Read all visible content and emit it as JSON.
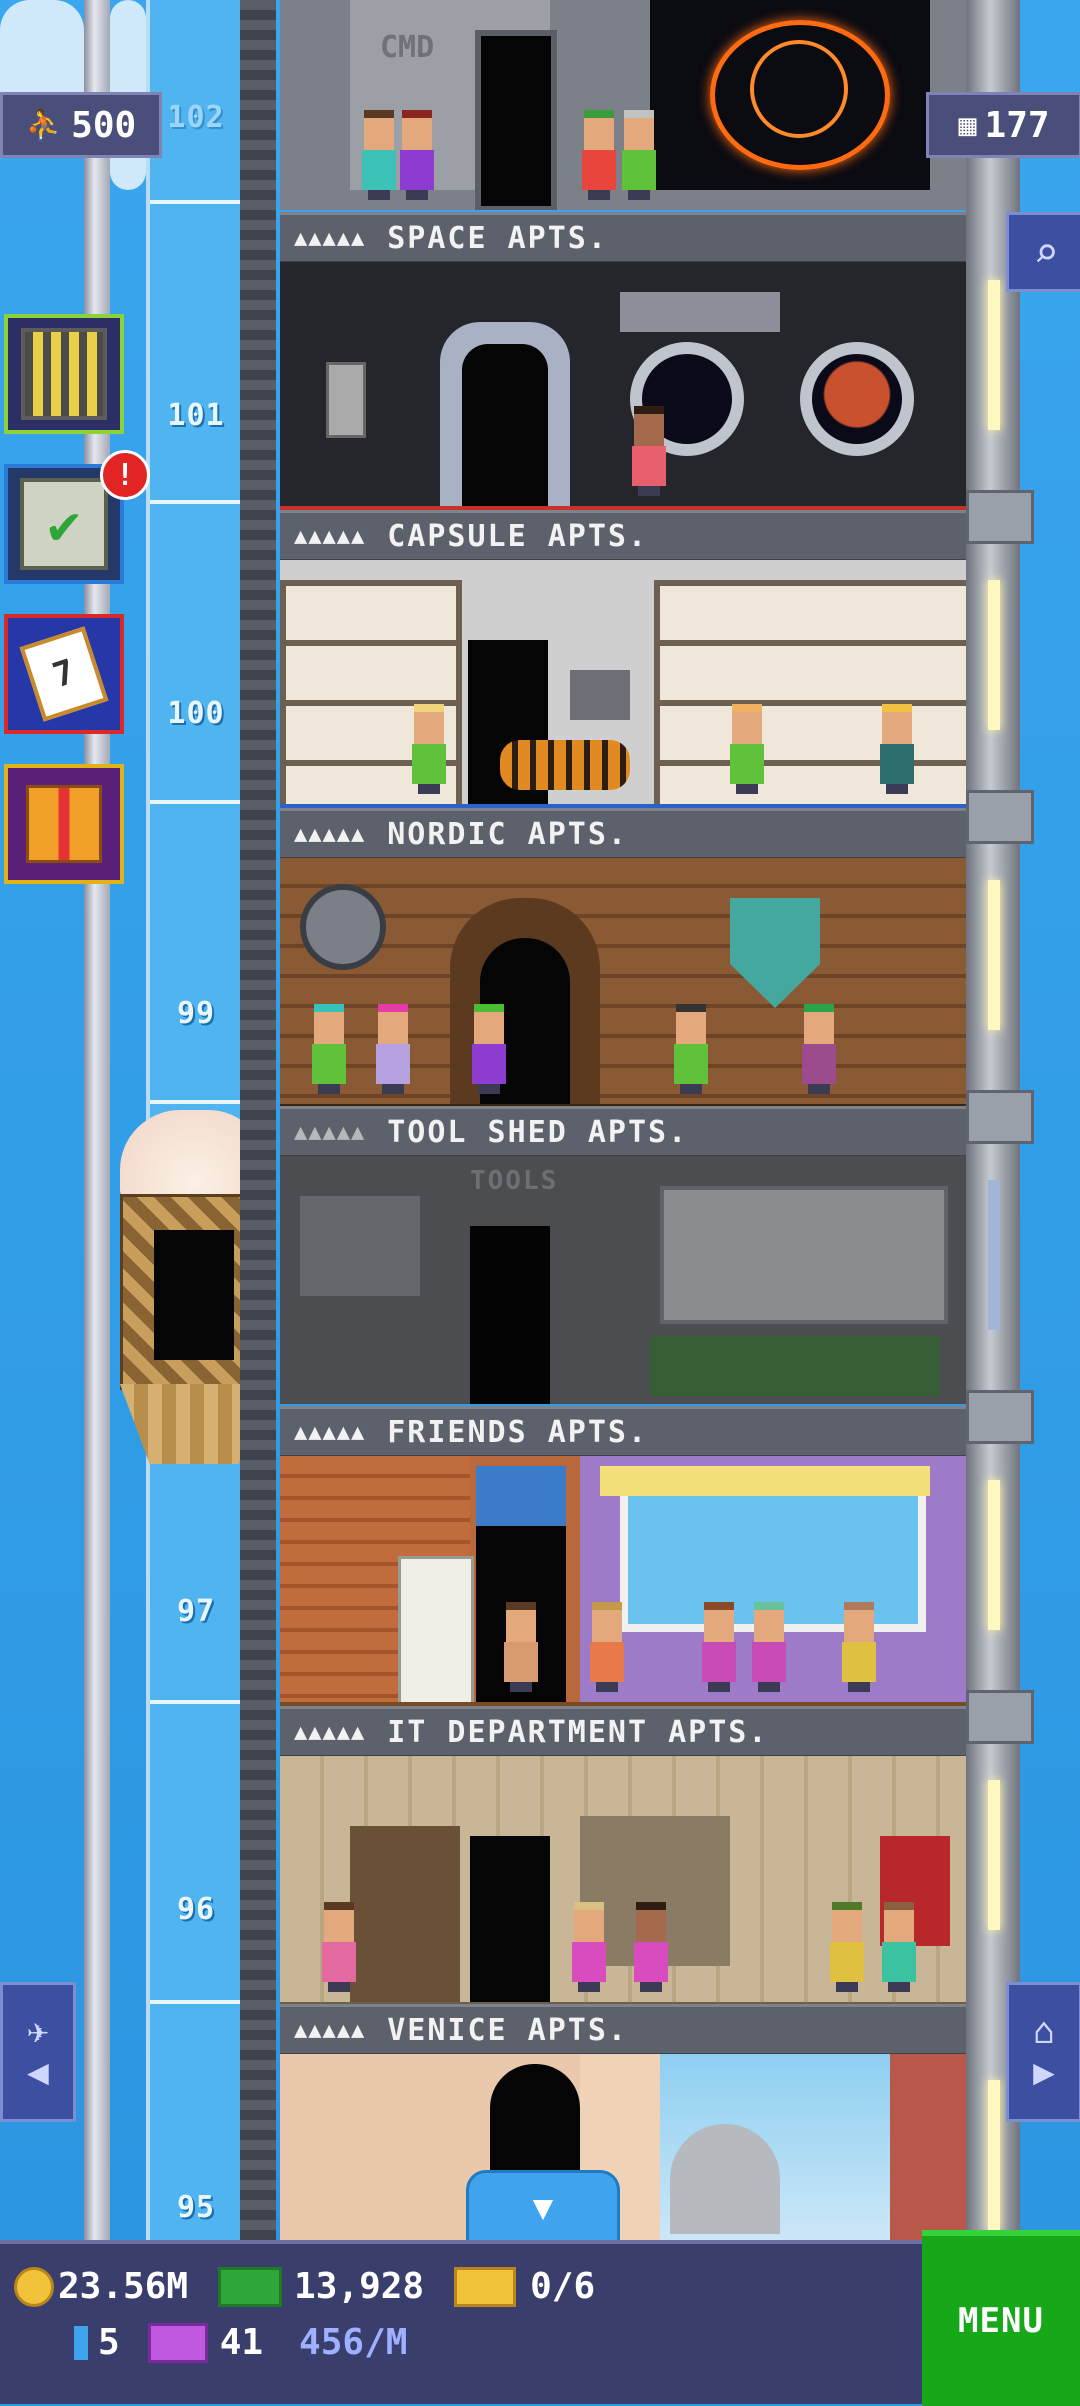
{
  "top": {
    "population": "500",
    "floors_count": "177",
    "shaft_floor_partial": "102"
  },
  "elevator_shaft_numbers": [
    "101",
    "100",
    "99",
    "97",
    "96",
    "95"
  ],
  "floors": [
    {
      "name": "SPACE APTS.",
      "stars": "▲▲▲▲▲"
    },
    {
      "name": "CAPSULE APTS.",
      "stars": "▲▲▲▲▲"
    },
    {
      "name": "NORDIC APTS.",
      "stars": "▲▲▲▲▲"
    },
    {
      "name": "TOOL SHED APTS.",
      "stars": "▲▲▲▲▲"
    },
    {
      "name": "FRIENDS APTS.",
      "stars": "▲▲▲▲▲"
    },
    {
      "name": "IT DEPARTMENT APTS.",
      "stars": "▲▲▲▲▲"
    },
    {
      "name": "VENICE APTS.",
      "stars": "▲▲▲▲▲"
    }
  ],
  "room_signs": {
    "space_door": "CMD",
    "tool_shed_sign": "TOOLS"
  },
  "side_buttons": [
    {
      "icon": "building-icon"
    },
    {
      "icon": "mission-checklist-icon",
      "badge": "!"
    },
    {
      "icon": "calendar-icon",
      "day": "7"
    },
    {
      "icon": "gift-icon"
    }
  ],
  "bottom": {
    "coins": "23.56M",
    "bux": "13,928",
    "tickets": "0/6",
    "keys": "5",
    "vip": "41",
    "rate": "456/M",
    "menu": "MENU"
  },
  "colors": {
    "sky": "#2a9be6",
    "menu_green": "#17a81a",
    "bar_purple": "#3a3e6d",
    "label_gray": "#5c616b"
  }
}
